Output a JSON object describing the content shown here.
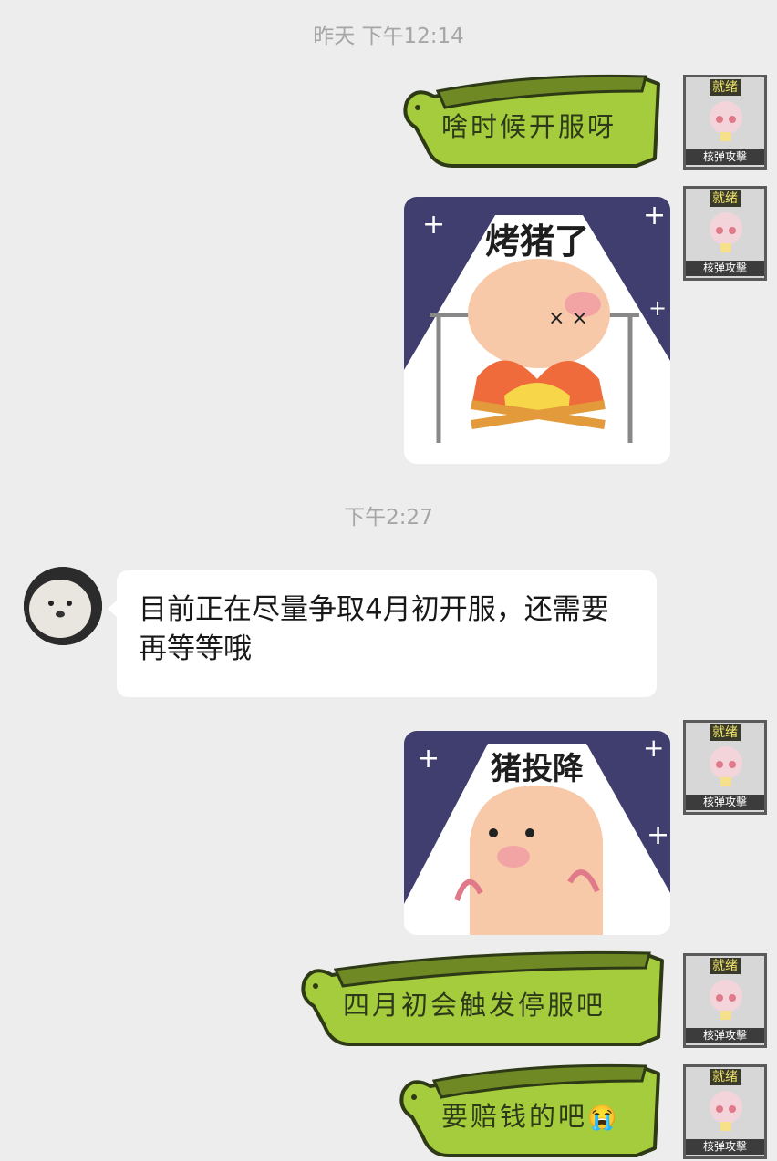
{
  "timestamps": [
    "昨天 下午12:14",
    "下午2:27"
  ],
  "self_avatar": {
    "status_tag": "就绪",
    "name_tag": "核弹攻擊"
  },
  "messages": [
    {
      "type": "text",
      "sender": "self",
      "text": "啥时候开服呀"
    },
    {
      "type": "sticker",
      "sender": "self",
      "caption": "烤猪了"
    },
    {
      "type": "text",
      "sender": "other",
      "text": "目前正在尽量争取4月初开服，还需要再等等哦"
    },
    {
      "type": "sticker",
      "sender": "self",
      "caption": "猪投降"
    },
    {
      "type": "text",
      "sender": "self",
      "text": "四月初会触发停服吧"
    },
    {
      "type": "text",
      "sender": "self",
      "text": "要赔钱的吧",
      "emoji": "😭"
    }
  ],
  "colors": {
    "background": "#ededed",
    "turtle_bubble": "#a5cc3c",
    "turtle_outline": "#2e3a16",
    "other_bubble": "#ffffff",
    "timestamp": "#a6a6a6"
  }
}
